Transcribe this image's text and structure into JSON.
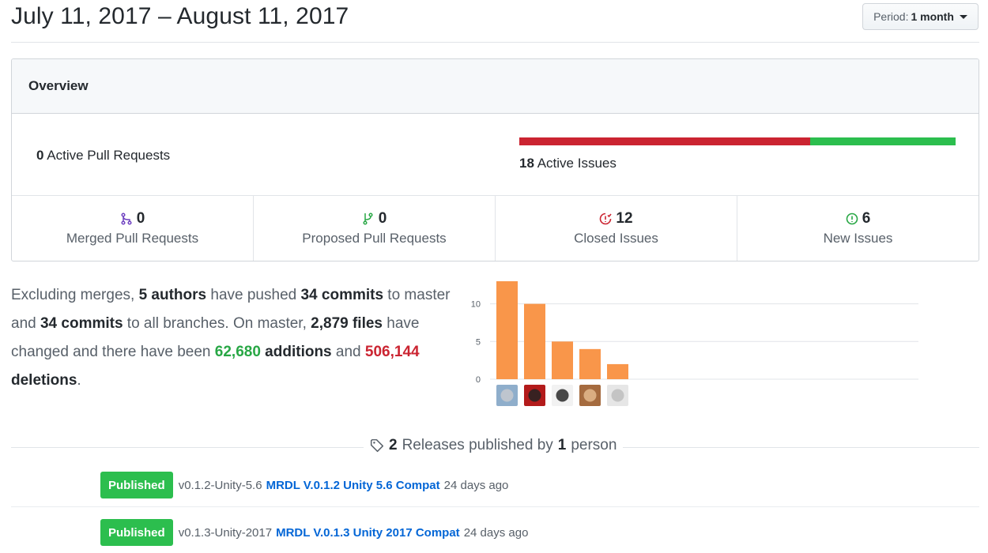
{
  "header": {
    "title": "July 11, 2017 – August 11, 2017",
    "period_prefix": "Period:",
    "period_value": "1 month"
  },
  "overview": {
    "heading": "Overview",
    "active_pull_requests": {
      "count": "0",
      "label": "Active Pull Requests"
    },
    "active_issues": {
      "count": "18",
      "label": "Active Issues",
      "closed_fraction": 0.667
    },
    "stats": [
      {
        "icon": "merged-pr-icon",
        "count": "0",
        "label": "Merged Pull Requests"
      },
      {
        "icon": "proposed-pr-icon",
        "count": "0",
        "label": "Proposed Pull Requests"
      },
      {
        "icon": "closed-issue-icon",
        "count": "12",
        "label": "Closed Issues"
      },
      {
        "icon": "new-issue-icon",
        "count": "6",
        "label": "New Issues"
      }
    ],
    "colors": {
      "closed": "#cb2431",
      "open": "#2cbe4e",
      "merged": "#6f42c1",
      "proposed": "#28a745"
    }
  },
  "summary": {
    "t1": "Excluding merges, ",
    "authors": "5 authors",
    "t2": " have pushed ",
    "commits_master": "34 commits",
    "t3": " to master and ",
    "commits_all": "34 commits",
    "t4": " to all branches. On master, ",
    "files": "2,879 files",
    "t5": " have changed and there have been ",
    "additions_num": "62,680",
    "additions_word": " additions",
    "t6": " and ",
    "deletions_num": "506,144",
    "deletions_word": " deletions",
    "t7": "."
  },
  "chart_data": {
    "type": "bar",
    "categories": [
      "author-1",
      "author-2",
      "author-3",
      "author-4",
      "author-5"
    ],
    "values": [
      13,
      10,
      5,
      4,
      2
    ],
    "ylim": [
      0,
      13
    ],
    "yticks": [
      "0",
      "5",
      "10"
    ],
    "grid": true,
    "bar_color": "#f9964a"
  },
  "releases": {
    "count": "2",
    "t1": " Releases published by ",
    "people": "1",
    "t2": " person",
    "items": [
      {
        "badge": "Published",
        "tag": "v0.1.2-Unity-5.6",
        "name": "MRDL V.0.1.2 Unity 5.6 Compat",
        "ago": "24 days ago"
      },
      {
        "badge": "Published",
        "tag": "v0.1.3-Unity-2017",
        "name": "MRDL V.0.1.3 Unity 2017 Compat",
        "ago": "24 days ago"
      }
    ]
  }
}
